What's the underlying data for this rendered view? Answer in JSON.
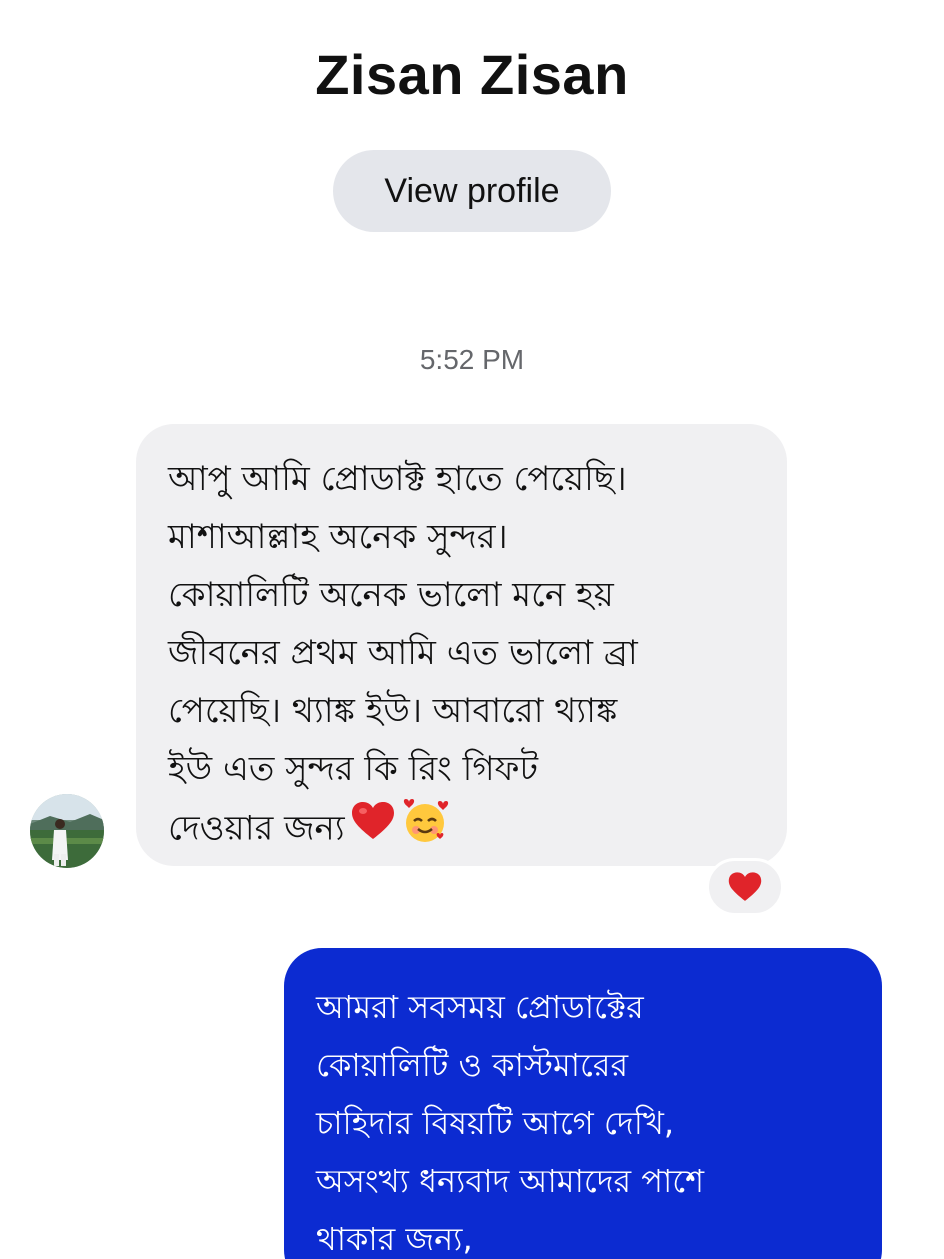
{
  "header": {
    "contact_name": "Zisan Zisan",
    "view_profile_label": "View profile"
  },
  "conversation": {
    "timestamp": "5:52 PM",
    "incoming_message": {
      "text": "আপু আমি প্রোডাক্ট হাতে পেয়েছি।\nমাশাআল্লাহ অনেক সুন্দর।\nকোয়ালিটি অনেক ভালো মনে হয়\nজীবনের প্রথম আমি এত ভালো ব্রা\nপেয়েছি। থ্যাঙ্ক ইউ। আবারো থ্যাঙ্ক\nইউ এত সুন্দর কি রিং গিফট\nদেওয়ার জন্য",
      "trailing_emojis": [
        "red-heart",
        "smiling-face-with-hearts"
      ],
      "reaction": "red-heart",
      "bubble_color": "#f0f0f2"
    },
    "outgoing_message": {
      "text": "আমরা সবসময় প্রোডাক্টের\nকোয়ালিটি ও কাস্টমারের\nচাহিদার বিষয়টি আগে দেখি,\nঅসংখ্য ধন্যবাদ আমাদের পাশে\nথাকার জন্য,",
      "bubble_color": "#0c2bd1"
    }
  }
}
